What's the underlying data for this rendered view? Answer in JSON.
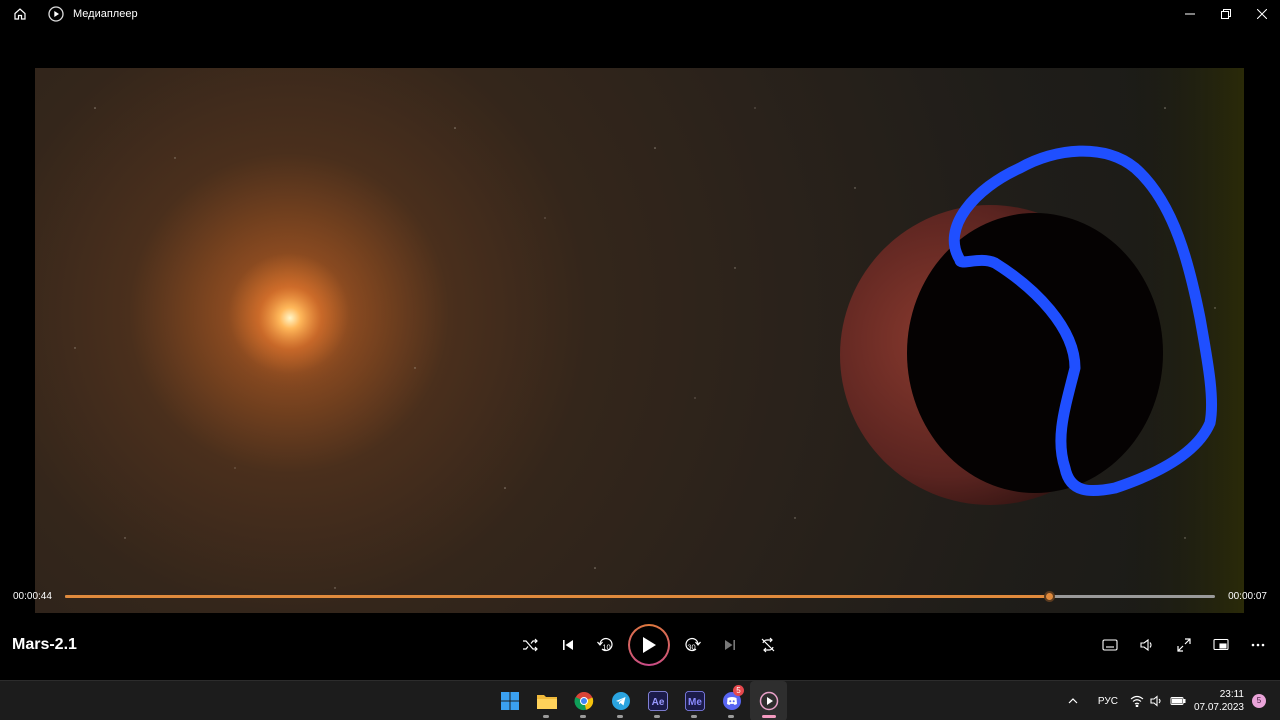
{
  "window": {
    "title": "Медиаплеер"
  },
  "player": {
    "media_title": "Mars-2.1",
    "current_time": "00:00:44",
    "remaining_time": "00:00:07",
    "progress": 0.856
  },
  "controls": {
    "center": [
      {
        "name": "shuffle-button",
        "icon": "shuffle-icon"
      },
      {
        "name": "previous-button",
        "icon": "skip-previous-icon"
      },
      {
        "name": "rewind-10-button",
        "icon": "rewind-10-icon",
        "label": "10"
      },
      {
        "name": "play-button",
        "icon": "play-icon"
      },
      {
        "name": "forward-30-button",
        "icon": "forward-30-icon",
        "label": "30"
      },
      {
        "name": "next-button",
        "icon": "skip-next-icon"
      },
      {
        "name": "repeat-button",
        "icon": "repeat-off-icon"
      }
    ],
    "right": [
      {
        "name": "subtitles-button",
        "icon": "subtitles-icon"
      },
      {
        "name": "volume-button",
        "icon": "volume-icon"
      },
      {
        "name": "fullscreen-button",
        "icon": "fullscreen-icon"
      },
      {
        "name": "miniplayer-button",
        "icon": "miniplayer-icon"
      },
      {
        "name": "more-button",
        "icon": "more-icon"
      }
    ]
  },
  "taskbar": {
    "apps": [
      {
        "name": "start",
        "icon": "windows-icon"
      },
      {
        "name": "file-explorer",
        "icon": "folder-icon"
      },
      {
        "name": "chrome",
        "icon": "chrome-icon"
      },
      {
        "name": "telegram",
        "icon": "telegram-icon"
      },
      {
        "name": "after-effects",
        "icon": "after-effects-icon",
        "label": "Ae"
      },
      {
        "name": "media-encoder",
        "icon": "media-encoder-icon",
        "label": "Me"
      },
      {
        "name": "discord",
        "icon": "discord-icon",
        "badge": "5"
      },
      {
        "name": "media-player",
        "icon": "media-player-icon"
      }
    ],
    "tray": {
      "language": "РУС",
      "time": "23:11",
      "date": "07.07.2023",
      "notification_count": "5"
    }
  },
  "colors": {
    "accent": "#e08a3c",
    "annotation_stroke": "#1f4fff",
    "planet": "#6a2a22"
  }
}
